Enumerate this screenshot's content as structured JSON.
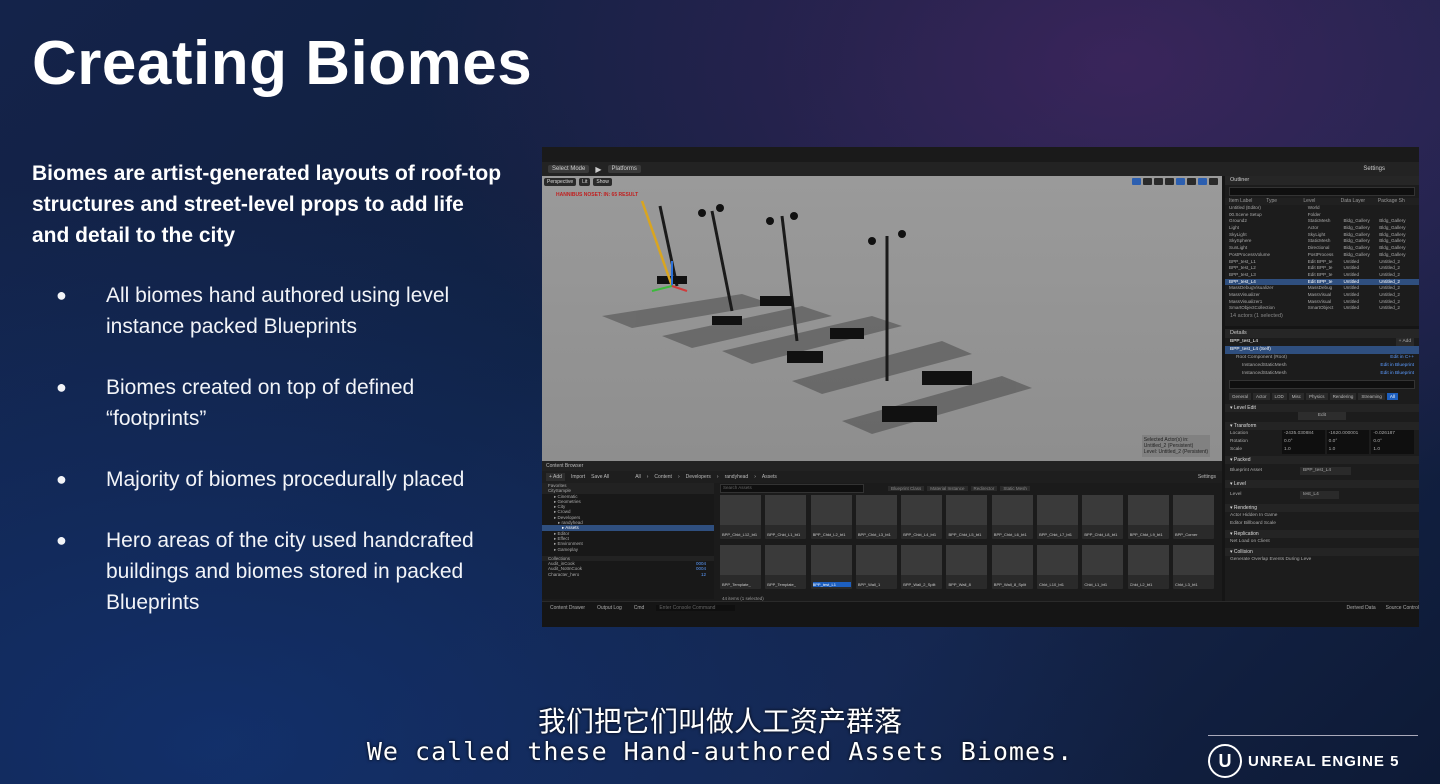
{
  "slide": {
    "title": "Creating Biomes",
    "intro": "Biomes are artist-generated layouts of roof-top structures and street-level props to add life and detail to the city",
    "bullets": [
      "All biomes hand authored using level instance packed Blueprints",
      "Biomes created on top of defined “footprints”",
      "Majority of biomes procedurally placed",
      "Hero areas of the city used handcrafted buildings and biomes stored in packed Blueprints"
    ],
    "bullet_glyph": "●"
  },
  "subtitles": {
    "zh": "我们把它们叫做人工资产群落",
    "en": "We called these Hand-authored Assets Biomes."
  },
  "logo": {
    "mark": "U",
    "text": "UNREAL ENGINE 5"
  },
  "editor": {
    "toolbar": {
      "select_mode": "Select Mode",
      "platforms": "Platforms",
      "settings": "Settings"
    },
    "viewport": {
      "perspective": "Perspective",
      "lit": "Lit",
      "show": "Show",
      "warning": "HANNIBUS NOSET: IN: 65 RESULT",
      "selected_info": [
        "Selected Actor(s) in:",
        "Untitled_2 (Persistent)",
        "Level: Untitled_2 (Persistent)"
      ]
    },
    "outliner": {
      "tab": "Outliner",
      "columns": [
        "Item Label",
        "Type",
        "Level",
        "Data Layer",
        "Package Sh"
      ],
      "rows": [
        [
          "Untitled (Editor)",
          "World",
          "",
          ""
        ],
        [
          "00.Scene Setup",
          "Folder",
          "",
          ""
        ],
        [
          "Ground2",
          "StaticMesh",
          "Bldg_Gallery",
          "Bldg_Gallery"
        ],
        [
          "Light",
          "Actor",
          "Bldg_Gallery",
          "Bldg_Gallery"
        ],
        [
          "SkyLight",
          "SkyLight",
          "Bldg_Gallery",
          "Bldg_Gallery"
        ],
        [
          "SkySphere",
          "StaticMesh",
          "Bldg_Gallery",
          "Bldg_Gallery"
        ],
        [
          "SunLight",
          "Directional",
          "Bldg_Gallery",
          "Bldg_Gallery"
        ],
        [
          "PostProcessVolume",
          "PostProcess",
          "Bldg_Gallery",
          "Bldg_Gallery"
        ],
        [
          "BPP_test_L1",
          "Edit BPP_te",
          "Untitled",
          "Untitled_2"
        ],
        [
          "BPP_test_L2",
          "Edit BPP_te",
          "Untitled",
          "Untitled_2"
        ],
        [
          "BPP_test_L3",
          "Edit BPP_te",
          "Untitled",
          "Untitled_2"
        ],
        [
          "BPP_test_L4",
          "Edit BPP_te",
          "Untitled",
          "Untitled_2"
        ],
        [
          "MassDebugVisualizer",
          "MassDebug",
          "Untitled",
          "Untitled_2"
        ],
        [
          "MassVisualizer",
          "MassVisual",
          "Untitled",
          "Untitled_2"
        ],
        [
          "MassVisualizer1",
          "MassVisual",
          "Untitled",
          "Untitled_2"
        ],
        [
          "SmartObjectCollection",
          "SmartObject",
          "Untitled",
          "Untitled_2"
        ]
      ],
      "selected_row": 11,
      "footer": "14 actors (1 selected)"
    },
    "details": {
      "tab": "Details",
      "actor": "BPP_test_L4",
      "add": "+ Add",
      "components": [
        [
          "BPP_test_L4 (Self)",
          ""
        ],
        [
          "Root Component (Root)",
          "Edit in C++"
        ],
        [
          "InstancedStaticMesh",
          "Edit in Blueprint"
        ],
        [
          "InstancedStaticMesh",
          "Edit in Blueprint"
        ]
      ],
      "tabs": [
        "General",
        "Actor",
        "LOD",
        "Misc",
        "Physics",
        "Rendering",
        "Streaming",
        "All"
      ],
      "sections": [
        "Level Edit",
        "Transform",
        "Packed",
        "Level",
        "Rendering",
        "Replication",
        "Collision"
      ],
      "transform": [
        [
          "Location",
          "-2435.030884",
          "-1620.000001",
          "-0.026187"
        ],
        [
          "Rotation",
          "0.0°",
          "0.0°",
          "0.0°"
        ],
        [
          "Scale",
          "1.0",
          "1.0",
          "1.0"
        ]
      ],
      "edit": "Edit",
      "blueprint_asset": "Blueprint Asset",
      "blueprint_value": "BPP_test_L4",
      "level_label": "Level",
      "level_value": "test_L4",
      "props": [
        "Actor Hidden In Game",
        "Editor Billboard Scale",
        "Net Load on Client",
        "Generate Overlap Events During Leve"
      ]
    },
    "content_browser": {
      "tab": "Content Browser",
      "add": "+ Add",
      "import": "Import",
      "save_all": "Save All",
      "path": [
        "All",
        "Content",
        "Developers",
        "randyhead",
        "Assets"
      ],
      "settings": "Settings",
      "favorites": "Favorites",
      "root": "CitySample",
      "tree": [
        "Cinematic",
        "Geometries",
        "City",
        "Crowd",
        "Developers",
        "randyhead",
        "Assets",
        "Editor",
        "Effect",
        "Environment",
        "Gameplay"
      ],
      "selected_tree": 6,
      "collections": "Collections",
      "collection_rows": [
        [
          "Audit_inCook",
          "0004"
        ],
        [
          "Audit_NotInCook",
          "0004"
        ],
        [
          "Character_hero",
          "12"
        ]
      ],
      "search_placeholder": "Search Assets",
      "filters": [
        "Blueprint Class",
        "Material Instance",
        "Redirector",
        "Static Mesh"
      ],
      "tiles": [
        "BPP_Chkt_L12_bt1",
        "BPP_Chkt_L1_bt1",
        "BPP_Chkt_L2_bt1",
        "BPP_Chkt_L3_bt1",
        "BPP_Chkt_L4_bt1",
        "BPP_Chkt_L5_bt1",
        "BPP_Chkt_L6_bt1",
        "BPP_Chkt_L7_bt1",
        "BPP_Chkt_L8_bt1",
        "BPP_Chkt_L9_bt1",
        "BPP_Corner",
        "BPP_Template_",
        "BPP_Template_",
        "BPP_test_L1",
        "BPP_Wall_1",
        "BPP_Wall_2_Split",
        "BPP_Wall_8",
        "BPP_Wall_8_Split",
        "Chkt_L10_bt1",
        "Chkt_L1_bt1",
        "Chkt_L2_bt1",
        "Chkt_L3_bt1"
      ],
      "selected_tile": 13,
      "footer": "44 items (1 selected)"
    },
    "bottombar": {
      "items": [
        "Content Drawer",
        "Output Log",
        "Cmd",
        "Enter Console Command"
      ],
      "right": [
        "Derived Data",
        "Source Control"
      ]
    }
  }
}
